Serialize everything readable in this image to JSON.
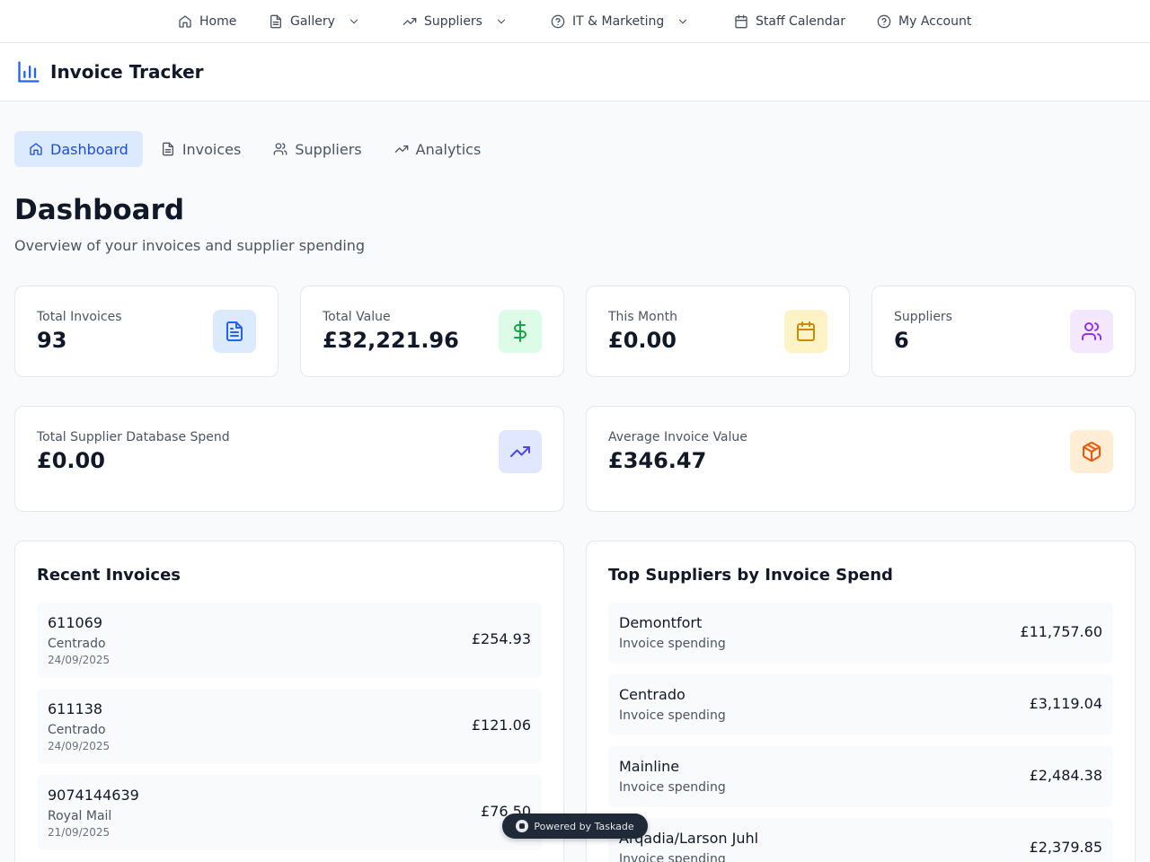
{
  "topnav": {
    "home": "Home",
    "gallery": "Gallery",
    "suppliers": "Suppliers",
    "it_marketing": "IT & Marketing",
    "staff_calendar": "Staff Calendar",
    "my_account": "My Account"
  },
  "app": {
    "title": "Invoice Tracker"
  },
  "tabs": {
    "dashboard": "Dashboard",
    "invoices": "Invoices",
    "suppliers": "Suppliers",
    "analytics": "Analytics"
  },
  "page": {
    "title": "Dashboard",
    "subtitle": "Overview of your invoices and supplier spending"
  },
  "stats": {
    "total_invoices": {
      "label": "Total Invoices",
      "value": "93"
    },
    "total_value": {
      "label": "Total Value",
      "value": "£32,221.96"
    },
    "this_month": {
      "label": "This Month",
      "value": "£0.00"
    },
    "suppliers": {
      "label": "Suppliers",
      "value": "6"
    },
    "supplier_db_spend": {
      "label": "Total Supplier Database Spend",
      "value": "£0.00"
    },
    "avg_invoice": {
      "label": "Average Invoice Value",
      "value": "£346.47"
    }
  },
  "recent": {
    "title": "Recent Invoices",
    "items": [
      {
        "number": "611069",
        "supplier": "Centrado",
        "date": "24/09/2025",
        "amount": "£254.93"
      },
      {
        "number": "611138",
        "supplier": "Centrado",
        "date": "24/09/2025",
        "amount": "£121.06"
      },
      {
        "number": "9074144639",
        "supplier": "Royal Mail",
        "date": "21/09/2025",
        "amount": "£76.50"
      }
    ]
  },
  "top": {
    "title": "Top Suppliers by Invoice Spend",
    "items": [
      {
        "name": "Demontfort",
        "sub": "Invoice spending",
        "amount": "£11,757.60"
      },
      {
        "name": "Centrado",
        "sub": "Invoice spending",
        "amount": "£3,119.04"
      },
      {
        "name": "Mainline",
        "sub": "Invoice spending",
        "amount": "£2,484.38"
      },
      {
        "name": "Arqadia/Larson Juhl",
        "sub": "Invoice spending",
        "amount": "£2,379.85"
      }
    ]
  },
  "badge": {
    "label": "Powered by Taskade"
  },
  "colors": {
    "accent": "#2563eb",
    "active_tab_bg": "#dbeafe",
    "blue_tile": "#dbeafe",
    "green_tile": "#dcfce7",
    "yellow_tile": "#fef3c7",
    "purple_tile": "#f3e8ff",
    "indigo_tile": "#e0e7ff",
    "orange_tile": "#ffedd5"
  },
  "icons": {
    "home": "home-icon",
    "gallery": "file-icon",
    "suppliers": "trending-up-icon",
    "it_marketing": "help-circle-icon",
    "staff_calendar": "calendar-icon",
    "my_account": "help-circle-icon",
    "app_logo": "bar-chart-icon",
    "total_invoices": "file-text-icon",
    "total_value": "dollar-icon",
    "this_month": "calendar-icon",
    "suppliers_stat": "users-icon",
    "db_spend": "trending-up-icon",
    "avg_invoice": "package-icon"
  }
}
